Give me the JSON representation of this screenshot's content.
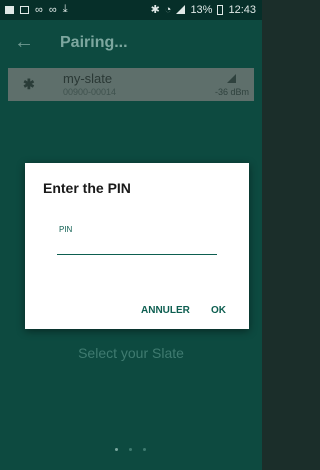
{
  "status_bar": {
    "left_icons": [
      "message-icon",
      "image-icon",
      "voicemail-icon",
      "voicemail-icon",
      "download-icon"
    ],
    "right_icons": [
      "bluetooth-icon",
      "wifi-icon",
      "signal-icon",
      "battery-icon"
    ],
    "battery_percent": "13%",
    "time": "12:43"
  },
  "toolbar": {
    "back_icon": "arrow-left-icon",
    "title": "Pairing..."
  },
  "device": {
    "icon": "bluetooth-icon",
    "name": "my-slate",
    "id": "00900-00014",
    "rssi": "-36 dBm"
  },
  "background": {
    "hint": "Select your Slate",
    "pager": {
      "count": 3,
      "active_index": 0
    }
  },
  "dialog": {
    "title": "Enter the PIN",
    "pin_label": "PIN",
    "pin_value": "",
    "cancel_label": "ANNULER",
    "ok_label": "OK"
  },
  "colors": {
    "app_background": "#0d4a40",
    "status_bar": "#062f29",
    "accent": "#0d5e50",
    "dialog_background": "#ffffff"
  }
}
